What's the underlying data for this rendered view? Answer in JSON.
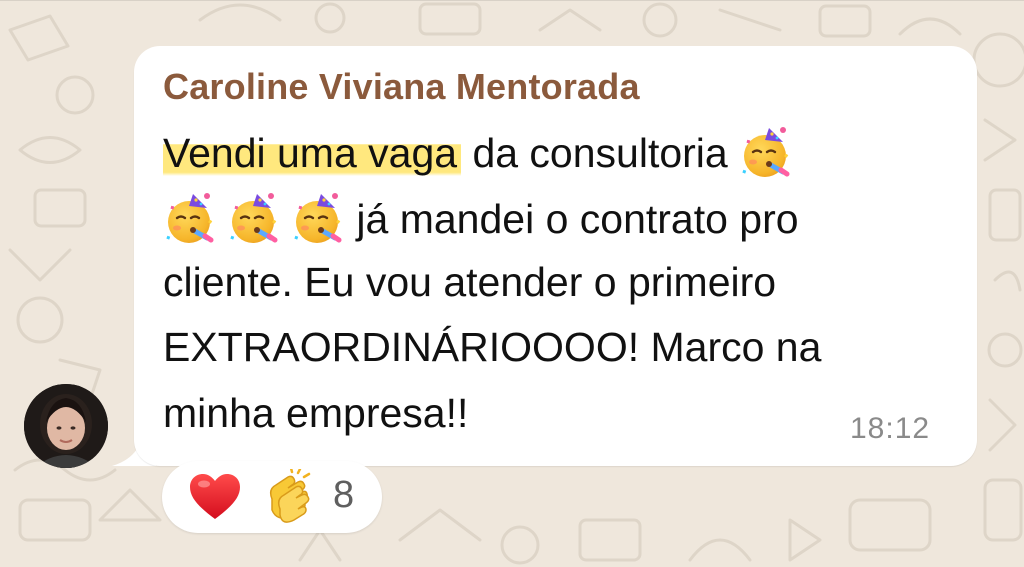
{
  "message": {
    "sender": "Caroline Viviana Mentorada",
    "line1_highlighted": "Vendi uma vaga",
    "line1_rest": " da consultoria",
    "line2_text": "já mandei o contrato pro",
    "line3_text": "cliente. Eu vou atender o primeiro",
    "line4_text": "EXTRAORDINÁRIOOOO! Marco na",
    "line5_text": "minha empresa!!",
    "time": "18:12"
  },
  "reactions": {
    "items": [
      "heart",
      "clapping-hands"
    ],
    "count": "8"
  },
  "colors": {
    "background": "#efe7dc",
    "bubble": "#ffffff",
    "sender": "#8b5a3c",
    "highlight": "#ffe25a",
    "timestamp": "#8a8a8a"
  }
}
